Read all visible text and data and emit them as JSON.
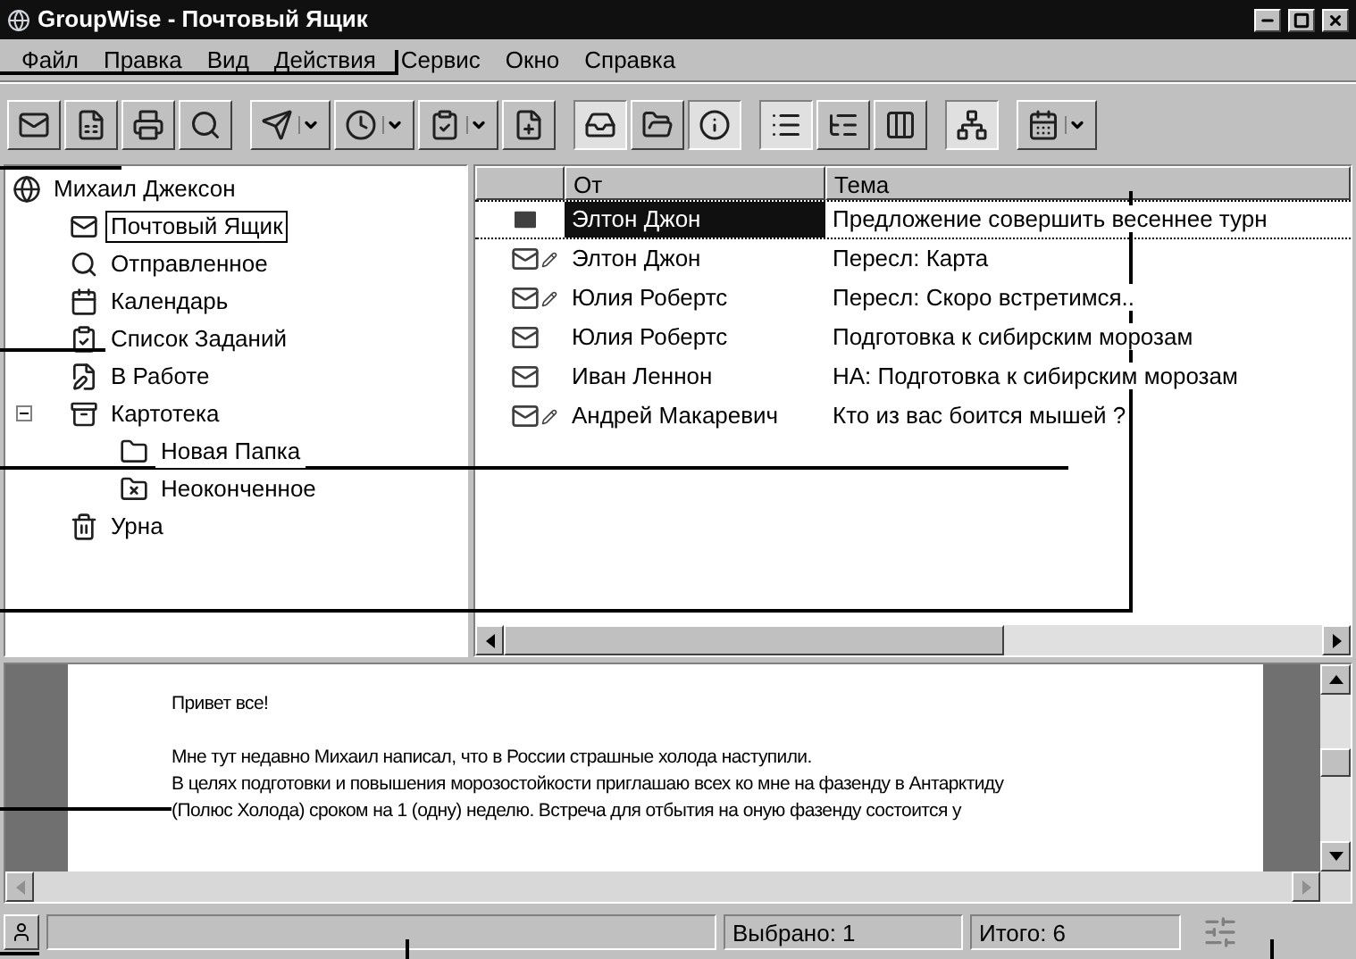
{
  "window": {
    "title": "GroupWise - Почтовый Ящик"
  },
  "menu": [
    "Файл",
    "Правка",
    "Вид",
    "Действия",
    "Сервис",
    "Окно",
    "Справка"
  ],
  "toolbar": [
    [
      {
        "pressed": false,
        "dropdown": false
      },
      {
        "pressed": false,
        "dropdown": false
      },
      {
        "pressed": false,
        "dropdown": false
      },
      {
        "pressed": false,
        "dropdown": false
      }
    ],
    [
      {
        "pressed": false,
        "dropdown": true
      },
      {
        "pressed": false,
        "dropdown": true
      },
      {
        "pressed": false,
        "dropdown": true
      },
      {
        "pressed": false,
        "dropdown": false
      }
    ],
    [
      {
        "pressed": true,
        "dropdown": false
      },
      {
        "pressed": false,
        "dropdown": false
      },
      {
        "pressed": true,
        "dropdown": false
      }
    ],
    [
      {
        "pressed": true,
        "dropdown": false
      },
      {
        "pressed": false,
        "dropdown": false
      },
      {
        "pressed": false,
        "dropdown": false
      }
    ],
    [
      {
        "pressed": true,
        "dropdown": false
      }
    ],
    [
      {
        "pressed": false,
        "dropdown": true
      }
    ]
  ],
  "tree": {
    "label": "Михаил Джексон",
    "selected": false,
    "children": [
      {
        "label": "Почтовый Ящик",
        "selected": true
      },
      {
        "label": "Отправленное",
        "selected": false
      },
      {
        "label": "Календарь",
        "selected": false
      },
      {
        "label": "Список Заданий",
        "selected": false
      },
      {
        "label": "В Работе",
        "selected": false
      },
      {
        "label": "Картотека",
        "selected": false,
        "expanded": true,
        "children": [
          {
            "label": "Новая Папка",
            "selected": false
          },
          {
            "label": "Неоконченное",
            "selected": false
          }
        ]
      },
      {
        "label": "Урна",
        "selected": false
      }
    ]
  },
  "table": {
    "columns": [
      "От",
      "Тема"
    ],
    "rows": [
      {
        "kind": "dark",
        "pencil": false,
        "from": "Элтон Джон",
        "subject": "Предложение совершить весеннее турн",
        "selected": true
      },
      {
        "kind": "outline",
        "pencil": true,
        "from": "Элтон Джон",
        "subject": "Пересл: Карта",
        "selected": false
      },
      {
        "kind": "outline",
        "pencil": true,
        "from": "Юлия Робертс",
        "subject": "Пересл: Скоро встретимся..",
        "selected": false
      },
      {
        "kind": "outline",
        "pencil": false,
        "from": "Юлия Робертс",
        "subject": "Подготовка к сибирским морозам",
        "selected": false
      },
      {
        "kind": "outline",
        "pencil": false,
        "from": "Иван Леннон",
        "subject": "НА: Подготовка к сибирским морозам",
        "selected": false
      },
      {
        "kind": "outline",
        "pencil": true,
        "from": "Андрей Макаревич",
        "subject": "Кто из вас боится мышей ?",
        "selected": false
      }
    ]
  },
  "preview": {
    "greeting": "Привет все!",
    "lines": [
      "Мне тут недавно Михаил написал, что в России страшные холода наступили.",
      "В целях подготовки и повышения морозостойкости приглашаю всех ко мне на фазенду в Антарктиду",
      "(Полюс Холода) сроком на 1 (одну) неделю. Встреча для отбытия на оную фазенду состоится у"
    ]
  },
  "status_bar": {
    "selected": "Выбрано: 1",
    "total": "Итого: 6"
  }
}
